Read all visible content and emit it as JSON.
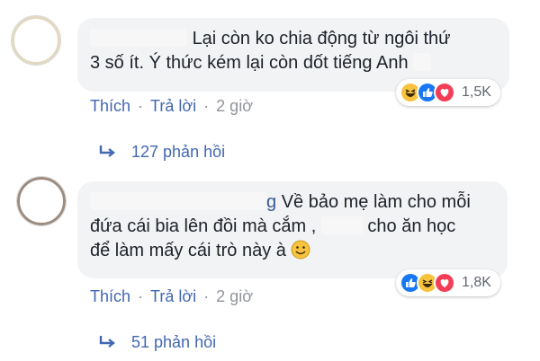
{
  "comments": [
    {
      "text_line1": "Lại còn ko chia động từ ngôi thứ",
      "text_line2": "3 số ít. Ý thức kém lại còn dốt tiếng Anh",
      "reaction_count": "1,5K",
      "actions": {
        "like": "Thích",
        "reply": "Trả lời",
        "time": "2 giờ"
      },
      "replies_label": "127 phản hồi"
    },
    {
      "name_tail": "g",
      "text_line1": "Về bảo mẹ làm cho mỗi",
      "text_line2a": "đứa cái bia lên đồi mà cắm ,",
      "text_line2b": "cho ăn học",
      "text_line3": "để làm mấy cái trò này à",
      "reaction_count": "1,8K",
      "actions": {
        "like": "Thích",
        "reply": "Trả lời",
        "time": "2 giờ"
      },
      "replies_label": "51 phản hồi"
    }
  ],
  "colors": {
    "link": "#4267b2",
    "bubble": "#f2f3f5",
    "meta": "#90949c",
    "like_blue": "#1877f2",
    "haha_yellow": "#f7c33f",
    "love_red": "#f33e58"
  },
  "icons": [
    "haha-icon",
    "like-icon",
    "love-icon",
    "reply-arrow-icon",
    "smile-emoji-icon"
  ]
}
